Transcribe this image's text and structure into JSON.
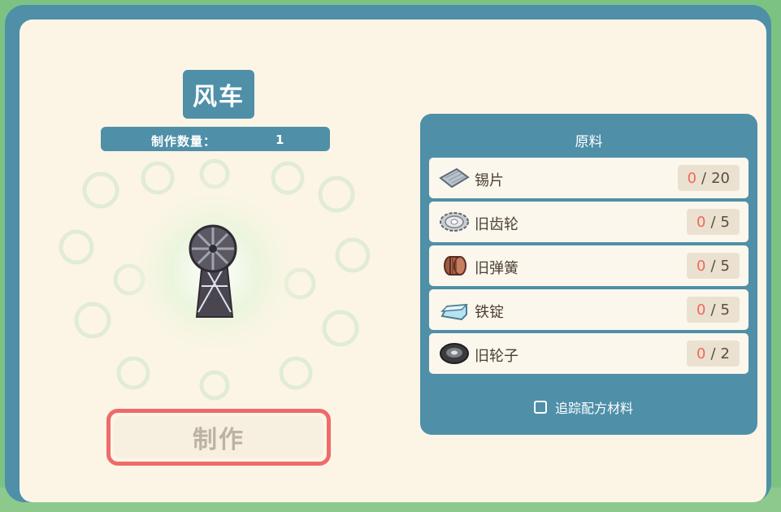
{
  "item": {
    "name": "风车",
    "quantity_label": "制作数量：",
    "quantity": "1",
    "icon": "windmill-icon"
  },
  "craft_button": {
    "label": "制作"
  },
  "materials": {
    "title": "原料",
    "items": [
      {
        "name": "锡片",
        "have": "0",
        "sep": "/",
        "need": "20",
        "icon": "tin-sheet-icon"
      },
      {
        "name": "旧齿轮",
        "have": "0",
        "sep": "/",
        "need": "5",
        "icon": "old-gear-icon"
      },
      {
        "name": "旧弹簧",
        "have": "0",
        "sep": "/",
        "need": "5",
        "icon": "old-spring-icon"
      },
      {
        "name": "铁锭",
        "have": "0",
        "sep": "/",
        "need": "5",
        "icon": "iron-ingot-icon"
      },
      {
        "name": "旧轮子",
        "have": "0",
        "sep": "/",
        "need": "2",
        "icon": "old-wheel-icon"
      }
    ],
    "track_label": "追踪配方材料"
  },
  "colors": {
    "panel_blue": "#4f8fa8",
    "cream": "#fcf5e5",
    "accent_red": "#ef6a6a",
    "count_have": "#ef6a5a",
    "background_green": "#7cc383"
  }
}
